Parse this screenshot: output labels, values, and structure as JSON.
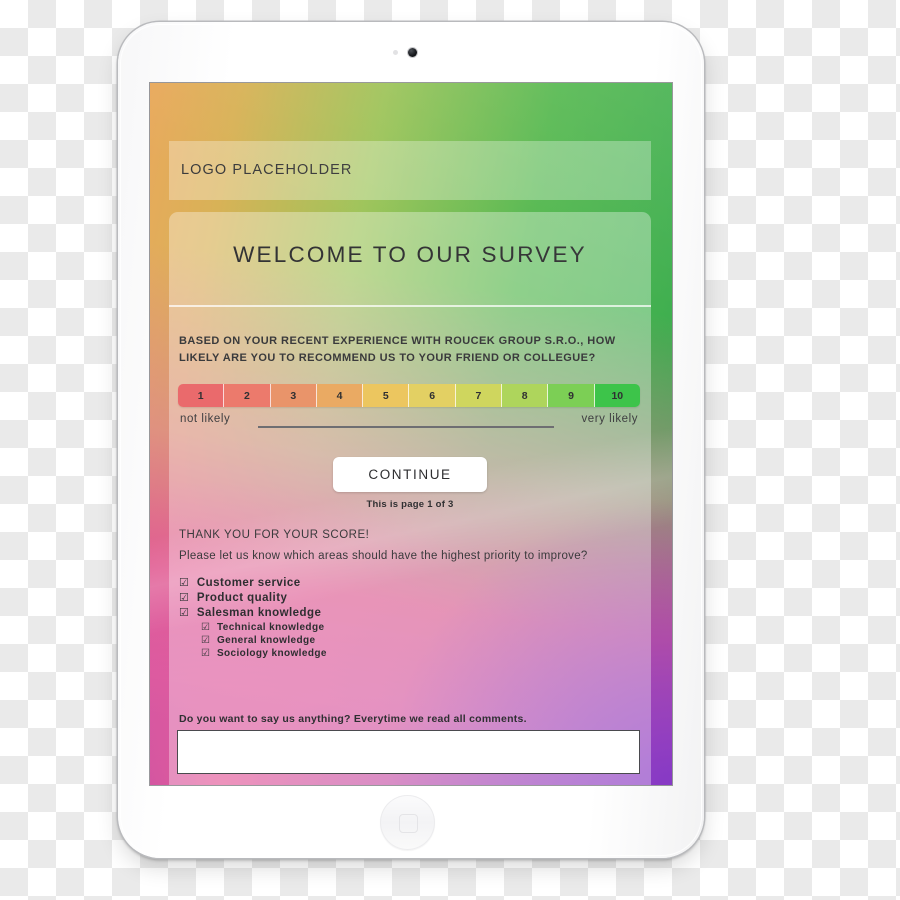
{
  "device": {
    "type": "tablet",
    "camera_icon": "camera-dot",
    "sensor_icon": "sensor-dot",
    "home_button_icon": "home-button-icon"
  },
  "header": {
    "logo_text": "LOGO PLACEHOLDER"
  },
  "welcome": {
    "title": "WELCOME TO OUR  SURVEY"
  },
  "question": {
    "text": "BASED ON YOUR RECENT EXPERIENCE WITH ROUCEK GROUP S.R.O., HOW LIKELY ARE YOU TO RECOMMEND US TO YOUR FRIEND OR COLLEGUE?"
  },
  "scale": {
    "values": [
      "1",
      "2",
      "3",
      "4",
      "5",
      "6",
      "7",
      "8",
      "9",
      "10"
    ],
    "colors": [
      "#ea6a6c",
      "#ec7a6c",
      "#e9946a",
      "#eaaa63",
      "#ecc65f",
      "#e3d063",
      "#cfd65e",
      "#aed55c",
      "#7ccf55",
      "#3dc44a"
    ],
    "left_label": "not likely",
    "right_label": "very likely"
  },
  "actions": {
    "continue_label": "CONTINUE",
    "page_indicator": "This is page 1 of 3"
  },
  "feedback": {
    "thanks_title": "THANK YOU FOR YOUR SCORE!",
    "thanks_subtitle": "Please let us know which areas should have the highest priority to improve?",
    "checkbox_glyph": "☑",
    "options": [
      {
        "label": "Customer service",
        "level": 1,
        "checked": true
      },
      {
        "label": "Product quality",
        "level": 1,
        "checked": true
      },
      {
        "label": "Salesman knowledge",
        "level": 1,
        "checked": true
      },
      {
        "label": "Technical knowledge",
        "level": 2,
        "checked": true
      },
      {
        "label": "General knowledge",
        "level": 2,
        "checked": true
      },
      {
        "label": "Sociology knowledge",
        "level": 2,
        "checked": true
      }
    ]
  },
  "comments": {
    "prompt": "Do you want to say us anything? Everytime we read all comments.",
    "value": "",
    "placeholder": ""
  },
  "palette": {
    "bg_top_left": "#e9a95c",
    "bg_top_right": "#2fa84c",
    "bg_bottom_left": "#e85c98",
    "bg_bottom_right": "#8b3ec4",
    "text_dark": "#3a3a3c",
    "card_overlay": "rgba(255,255,255,0.34)",
    "device_body": "#ffffff"
  }
}
